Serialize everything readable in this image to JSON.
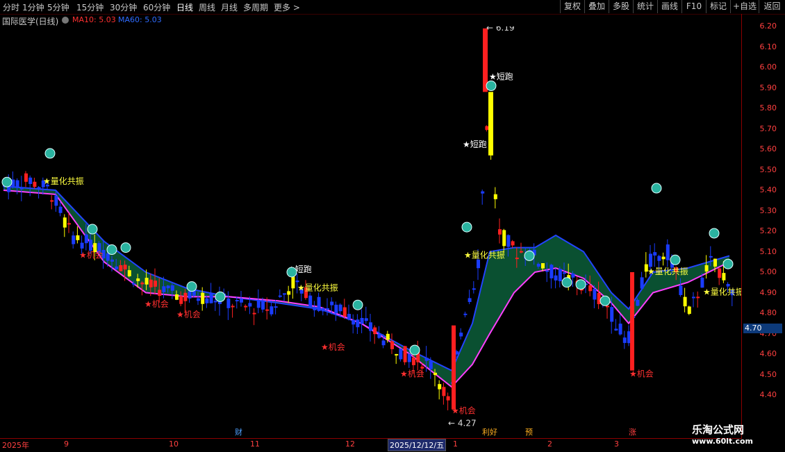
{
  "toolbar": {
    "periods": [
      "分时",
      "1分钟",
      "5分钟",
      "15分钟",
      "30分钟",
      "60分钟",
      "日线",
      "周线",
      "月线",
      "多周期",
      "更多 >"
    ],
    "active_period": "日线",
    "right_buttons": [
      "复权",
      "叠加",
      "多股",
      "统计",
      "画线",
      "F10",
      "标记",
      "+自选",
      "返回"
    ]
  },
  "header": {
    "title": "国际医学(日线)",
    "ma10": "MA10: 5.03",
    "ma60": "MA60: 5.03"
  },
  "chart_data": {
    "type": "candlestick",
    "price_axis": [
      "6.20",
      "6.10",
      "6.00",
      "5.90",
      "5.80",
      "5.70",
      "5.60",
      "5.50",
      "5.40",
      "5.30",
      "5.20",
      "5.10",
      "5.00",
      "4.90",
      "4.80",
      "4.70",
      "4.60",
      "4.50",
      "4.40"
    ],
    "current_price": "4.70",
    "high_marker": "6.19",
    "low_marker": "4.27",
    "annotations": [
      {
        "text": "量化共振"
      },
      {
        "text": "机会"
      },
      {
        "text": "短跑"
      }
    ],
    "date_labels": [
      "2025年",
      "9",
      "10",
      "11",
      "12",
      "1",
      "2",
      "3"
    ],
    "selected_date": "2025/12/12/五",
    "event_flags": [
      "财",
      "利好",
      "预",
      "涨"
    ]
  },
  "watermark": {
    "line1": "乐淘公式网",
    "line2": "www.60lt.com"
  },
  "colors": {
    "up": "#ff2020",
    "down": "#1a3cff",
    "signal": "#ffff00",
    "band_green": "#0c5e3a",
    "band_red": "#8a3030",
    "ma_line": "#ff40ff"
  }
}
